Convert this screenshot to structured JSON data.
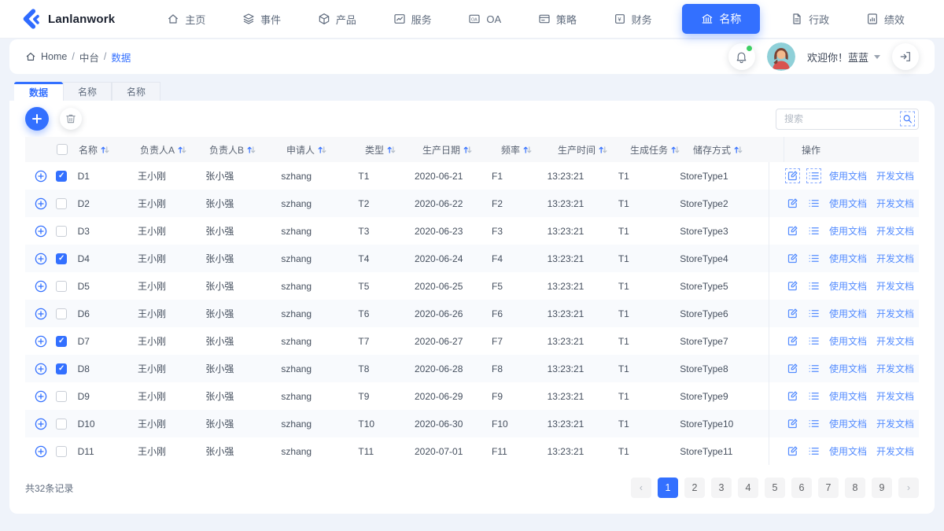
{
  "brand": {
    "name": "Lanlanwork"
  },
  "nav": {
    "items": [
      {
        "label": "主页",
        "icon": "home-icon",
        "active": false
      },
      {
        "label": "事件",
        "icon": "layers-icon",
        "active": false
      },
      {
        "label": "产品",
        "icon": "cube-icon",
        "active": false
      },
      {
        "label": "服务",
        "icon": "line-chart-icon",
        "active": false
      },
      {
        "label": "OA",
        "icon": "oa-badge-icon",
        "active": false
      },
      {
        "label": "策略",
        "icon": "card-icon",
        "active": false
      },
      {
        "label": "财务",
        "icon": "yuan-icon",
        "active": false
      },
      {
        "label": "名称",
        "icon": "bank-icon",
        "active": true
      },
      {
        "label": "行政",
        "icon": "document-icon",
        "active": false
      },
      {
        "label": "绩效",
        "icon": "report-icon",
        "active": false
      }
    ]
  },
  "breadcrumb": {
    "root": "Home",
    "separator": "/",
    "section": "中台",
    "current": "数据"
  },
  "header_right": {
    "greeting": "欢迎你！蓝蓝"
  },
  "tabs": [
    {
      "label": "数据",
      "active": true
    },
    {
      "label": "名称",
      "active": false
    },
    {
      "label": "名称",
      "active": false
    }
  ],
  "toolbar": {
    "search_placeholder": "搜索"
  },
  "table": {
    "columns": [
      "名称",
      "负责人A",
      "负责人B",
      "申请人",
      "类型",
      "生产日期",
      "频率",
      "生产时间",
      "生成任务",
      "储存方式"
    ],
    "actions_header": "操作",
    "action_links": [
      "使用文档",
      "开发文档"
    ],
    "rows": [
      {
        "name": "D1",
        "ownerA": "王小刚",
        "ownerB": "张小强",
        "applicant": "szhang",
        "type": "T1",
        "date": "2020-06-21",
        "freq": "F1",
        "time": "13:23:21",
        "task": "T1",
        "store": "StoreType1",
        "checked": true,
        "highlighted": true
      },
      {
        "name": "D2",
        "ownerA": "王小刚",
        "ownerB": "张小强",
        "applicant": "szhang",
        "type": "T2",
        "date": "2020-06-22",
        "freq": "F2",
        "time": "13:23:21",
        "task": "T1",
        "store": "StoreType2",
        "checked": false,
        "highlighted": false
      },
      {
        "name": "D3",
        "ownerA": "王小刚",
        "ownerB": "张小强",
        "applicant": "szhang",
        "type": "T3",
        "date": "2020-06-23",
        "freq": "F3",
        "time": "13:23:21",
        "task": "T1",
        "store": "StoreType3",
        "checked": false,
        "highlighted": false
      },
      {
        "name": "D4",
        "ownerA": "王小刚",
        "ownerB": "张小强",
        "applicant": "szhang",
        "type": "T4",
        "date": "2020-06-24",
        "freq": "F4",
        "time": "13:23:21",
        "task": "T1",
        "store": "StoreType4",
        "checked": true,
        "highlighted": false
      },
      {
        "name": "D5",
        "ownerA": "王小刚",
        "ownerB": "张小强",
        "applicant": "szhang",
        "type": "T5",
        "date": "2020-06-25",
        "freq": "F5",
        "time": "13:23:21",
        "task": "T1",
        "store": "StoreType5",
        "checked": false,
        "highlighted": false
      },
      {
        "name": "D6",
        "ownerA": "王小刚",
        "ownerB": "张小强",
        "applicant": "szhang",
        "type": "T6",
        "date": "2020-06-26",
        "freq": "F6",
        "time": "13:23:21",
        "task": "T1",
        "store": "StoreType6",
        "checked": false,
        "highlighted": false
      },
      {
        "name": "D7",
        "ownerA": "王小刚",
        "ownerB": "张小强",
        "applicant": "szhang",
        "type": "T7",
        "date": "2020-06-27",
        "freq": "F7",
        "time": "13:23:21",
        "task": "T1",
        "store": "StoreType7",
        "checked": true,
        "highlighted": false
      },
      {
        "name": "D8",
        "ownerA": "王小刚",
        "ownerB": "张小强",
        "applicant": "szhang",
        "type": "T8",
        "date": "2020-06-28",
        "freq": "F8",
        "time": "13:23:21",
        "task": "T1",
        "store": "StoreType8",
        "checked": true,
        "highlighted": false
      },
      {
        "name": "D9",
        "ownerA": "王小刚",
        "ownerB": "张小强",
        "applicant": "szhang",
        "type": "T9",
        "date": "2020-06-29",
        "freq": "F9",
        "time": "13:23:21",
        "task": "T1",
        "store": "StoreType9",
        "checked": false,
        "highlighted": false
      },
      {
        "name": "D10",
        "ownerA": "王小刚",
        "ownerB": "张小强",
        "applicant": "szhang",
        "type": "T10",
        "date": "2020-06-30",
        "freq": "F10",
        "time": "13:23:21",
        "task": "T1",
        "store": "StoreType10",
        "checked": false,
        "highlighted": false
      },
      {
        "name": "D11",
        "ownerA": "王小刚",
        "ownerB": "张小强",
        "applicant": "szhang",
        "type": "T11",
        "date": "2020-07-01",
        "freq": "F11",
        "time": "13:23:21",
        "task": "T1",
        "store": "StoreType11",
        "checked": false,
        "highlighted": false
      }
    ]
  },
  "footer": {
    "total": "共32条记录",
    "pages": [
      "1",
      "2",
      "3",
      "4",
      "5",
      "6",
      "7",
      "8",
      "9"
    ],
    "active_page": "1",
    "prev": "‹",
    "next": "›"
  },
  "colors": {
    "primary": "#3370ff",
    "link": "#548cff",
    "page_bg": "#eff3fa",
    "header_row_bg": "#f7f8fa",
    "alt_row_bg": "#f8fafd",
    "notification_dot": "#3ed065"
  }
}
